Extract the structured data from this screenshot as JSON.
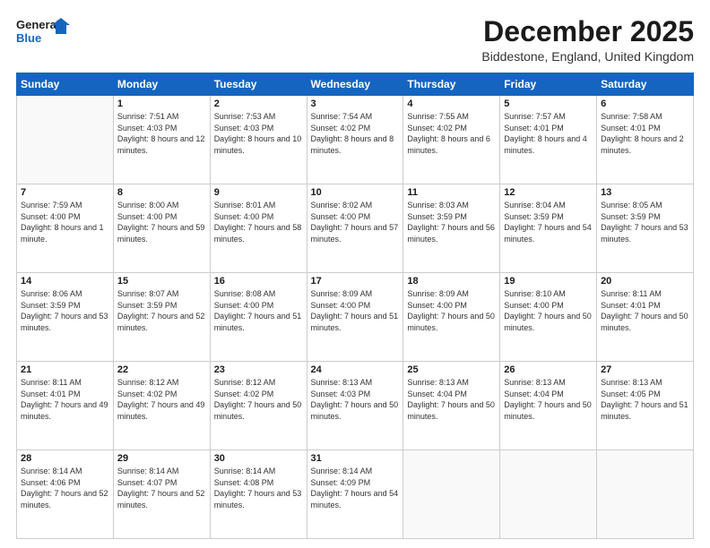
{
  "header": {
    "logo_line1": "General",
    "logo_line2": "Blue",
    "month_title": "December 2025",
    "location": "Biddestone, England, United Kingdom"
  },
  "days_of_week": [
    "Sunday",
    "Monday",
    "Tuesday",
    "Wednesday",
    "Thursday",
    "Friday",
    "Saturday"
  ],
  "weeks": [
    [
      {
        "day": "",
        "sunrise": "",
        "sunset": "",
        "daylight": ""
      },
      {
        "day": "1",
        "sunrise": "Sunrise: 7:51 AM",
        "sunset": "Sunset: 4:03 PM",
        "daylight": "Daylight: 8 hours and 12 minutes."
      },
      {
        "day": "2",
        "sunrise": "Sunrise: 7:53 AM",
        "sunset": "Sunset: 4:03 PM",
        "daylight": "Daylight: 8 hours and 10 minutes."
      },
      {
        "day": "3",
        "sunrise": "Sunrise: 7:54 AM",
        "sunset": "Sunset: 4:02 PM",
        "daylight": "Daylight: 8 hours and 8 minutes."
      },
      {
        "day": "4",
        "sunrise": "Sunrise: 7:55 AM",
        "sunset": "Sunset: 4:02 PM",
        "daylight": "Daylight: 8 hours and 6 minutes."
      },
      {
        "day": "5",
        "sunrise": "Sunrise: 7:57 AM",
        "sunset": "Sunset: 4:01 PM",
        "daylight": "Daylight: 8 hours and 4 minutes."
      },
      {
        "day": "6",
        "sunrise": "Sunrise: 7:58 AM",
        "sunset": "Sunset: 4:01 PM",
        "daylight": "Daylight: 8 hours and 2 minutes."
      }
    ],
    [
      {
        "day": "7",
        "sunrise": "Sunrise: 7:59 AM",
        "sunset": "Sunset: 4:00 PM",
        "daylight": "Daylight: 8 hours and 1 minute."
      },
      {
        "day": "8",
        "sunrise": "Sunrise: 8:00 AM",
        "sunset": "Sunset: 4:00 PM",
        "daylight": "Daylight: 7 hours and 59 minutes."
      },
      {
        "day": "9",
        "sunrise": "Sunrise: 8:01 AM",
        "sunset": "Sunset: 4:00 PM",
        "daylight": "Daylight: 7 hours and 58 minutes."
      },
      {
        "day": "10",
        "sunrise": "Sunrise: 8:02 AM",
        "sunset": "Sunset: 4:00 PM",
        "daylight": "Daylight: 7 hours and 57 minutes."
      },
      {
        "day": "11",
        "sunrise": "Sunrise: 8:03 AM",
        "sunset": "Sunset: 3:59 PM",
        "daylight": "Daylight: 7 hours and 56 minutes."
      },
      {
        "day": "12",
        "sunrise": "Sunrise: 8:04 AM",
        "sunset": "Sunset: 3:59 PM",
        "daylight": "Daylight: 7 hours and 54 minutes."
      },
      {
        "day": "13",
        "sunrise": "Sunrise: 8:05 AM",
        "sunset": "Sunset: 3:59 PM",
        "daylight": "Daylight: 7 hours and 53 minutes."
      }
    ],
    [
      {
        "day": "14",
        "sunrise": "Sunrise: 8:06 AM",
        "sunset": "Sunset: 3:59 PM",
        "daylight": "Daylight: 7 hours and 53 minutes."
      },
      {
        "day": "15",
        "sunrise": "Sunrise: 8:07 AM",
        "sunset": "Sunset: 3:59 PM",
        "daylight": "Daylight: 7 hours and 52 minutes."
      },
      {
        "day": "16",
        "sunrise": "Sunrise: 8:08 AM",
        "sunset": "Sunset: 4:00 PM",
        "daylight": "Daylight: 7 hours and 51 minutes."
      },
      {
        "day": "17",
        "sunrise": "Sunrise: 8:09 AM",
        "sunset": "Sunset: 4:00 PM",
        "daylight": "Daylight: 7 hours and 51 minutes."
      },
      {
        "day": "18",
        "sunrise": "Sunrise: 8:09 AM",
        "sunset": "Sunset: 4:00 PM",
        "daylight": "Daylight: 7 hours and 50 minutes."
      },
      {
        "day": "19",
        "sunrise": "Sunrise: 8:10 AM",
        "sunset": "Sunset: 4:00 PM",
        "daylight": "Daylight: 7 hours and 50 minutes."
      },
      {
        "day": "20",
        "sunrise": "Sunrise: 8:11 AM",
        "sunset": "Sunset: 4:01 PM",
        "daylight": "Daylight: 7 hours and 50 minutes."
      }
    ],
    [
      {
        "day": "21",
        "sunrise": "Sunrise: 8:11 AM",
        "sunset": "Sunset: 4:01 PM",
        "daylight": "Daylight: 7 hours and 49 minutes."
      },
      {
        "day": "22",
        "sunrise": "Sunrise: 8:12 AM",
        "sunset": "Sunset: 4:02 PM",
        "daylight": "Daylight: 7 hours and 49 minutes."
      },
      {
        "day": "23",
        "sunrise": "Sunrise: 8:12 AM",
        "sunset": "Sunset: 4:02 PM",
        "daylight": "Daylight: 7 hours and 50 minutes."
      },
      {
        "day": "24",
        "sunrise": "Sunrise: 8:13 AM",
        "sunset": "Sunset: 4:03 PM",
        "daylight": "Daylight: 7 hours and 50 minutes."
      },
      {
        "day": "25",
        "sunrise": "Sunrise: 8:13 AM",
        "sunset": "Sunset: 4:04 PM",
        "daylight": "Daylight: 7 hours and 50 minutes."
      },
      {
        "day": "26",
        "sunrise": "Sunrise: 8:13 AM",
        "sunset": "Sunset: 4:04 PM",
        "daylight": "Daylight: 7 hours and 50 minutes."
      },
      {
        "day": "27",
        "sunrise": "Sunrise: 8:13 AM",
        "sunset": "Sunset: 4:05 PM",
        "daylight": "Daylight: 7 hours and 51 minutes."
      }
    ],
    [
      {
        "day": "28",
        "sunrise": "Sunrise: 8:14 AM",
        "sunset": "Sunset: 4:06 PM",
        "daylight": "Daylight: 7 hours and 52 minutes."
      },
      {
        "day": "29",
        "sunrise": "Sunrise: 8:14 AM",
        "sunset": "Sunset: 4:07 PM",
        "daylight": "Daylight: 7 hours and 52 minutes."
      },
      {
        "day": "30",
        "sunrise": "Sunrise: 8:14 AM",
        "sunset": "Sunset: 4:08 PM",
        "daylight": "Daylight: 7 hours and 53 minutes."
      },
      {
        "day": "31",
        "sunrise": "Sunrise: 8:14 AM",
        "sunset": "Sunset: 4:09 PM",
        "daylight": "Daylight: 7 hours and 54 minutes."
      },
      {
        "day": "",
        "sunrise": "",
        "sunset": "",
        "daylight": ""
      },
      {
        "day": "",
        "sunrise": "",
        "sunset": "",
        "daylight": ""
      },
      {
        "day": "",
        "sunrise": "",
        "sunset": "",
        "daylight": ""
      }
    ]
  ]
}
